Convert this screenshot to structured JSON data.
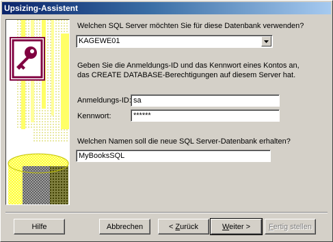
{
  "window": {
    "title": "Upsizing-Assistent"
  },
  "server": {
    "question": "Welchen SQL Server möchten Sie für diese Datenbank verwenden?",
    "selected": "KAGEWE01"
  },
  "login": {
    "instruction_line1": "Geben Sie die Anmeldungs-ID und das Kennwort eines Kontos an,",
    "instruction_line2": "das CREATE DATABASE-Berechtigungen auf diesem Server hat.",
    "id_label": "Anmeldungs-ID:",
    "id_value": "sa",
    "password_label": "Kennwort:",
    "password_value": "******"
  },
  "database": {
    "question": "Welchen Namen soll die neue SQL Server-Datenbank erhalten?",
    "name_value": "MyBooksSQL"
  },
  "buttons": {
    "help": "Hilfe",
    "cancel": "Abbrechen",
    "back_prefix": "< ",
    "back_accel": "Z",
    "back_rest": "urück",
    "next_accel": "W",
    "next_rest": "eiter >",
    "finish_accel": "F",
    "finish_rest": "ertig stellen"
  },
  "icons": {
    "illustration": "access-key-icon",
    "dropdown": "chevron-down-icon"
  },
  "colors": {
    "title_start": "#0a246a",
    "title_end": "#a6caf0",
    "face": "#d4d0c8",
    "access_maroon": "#800040",
    "pattern_yellow": "#ffff66"
  }
}
